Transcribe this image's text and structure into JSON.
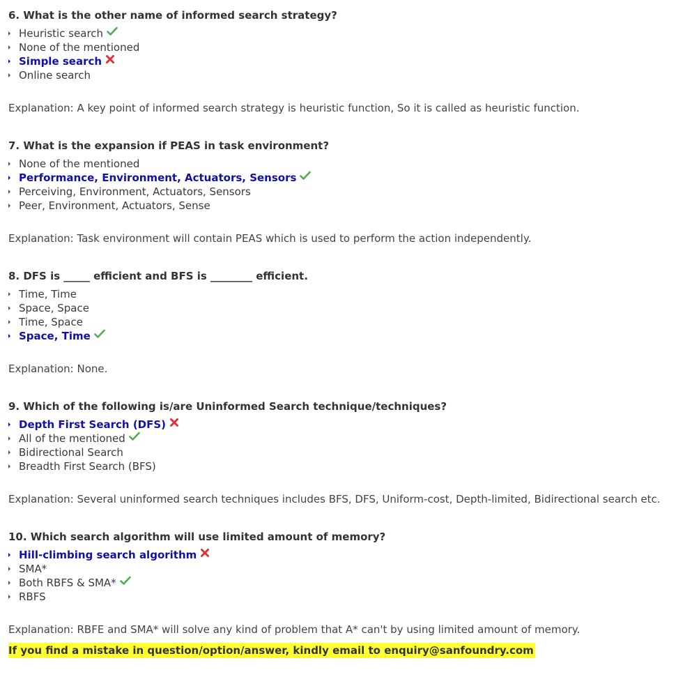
{
  "questions": [
    {
      "title": "6. What is the other name of informed search strategy?",
      "options": [
        {
          "label": "Heuristic search",
          "mark": "check"
        },
        {
          "label": "None of the mentioned",
          "mark": ""
        },
        {
          "label": "Simple search",
          "mark": "cross",
          "selected": true
        },
        {
          "label": "Online search",
          "mark": ""
        }
      ],
      "explanation": "Explanation: A key point of informed search strategy is heuristic function, So it is called as heuristic function."
    },
    {
      "title": "7. What is the expansion if PEAS in task environment?",
      "options": [
        {
          "label": "None of the mentioned",
          "mark": ""
        },
        {
          "label": "Performance, Environment, Actuators, Sensors",
          "mark": "check",
          "selected": true
        },
        {
          "label": "Perceiving, Environment, Actuators, Sensors",
          "mark": ""
        },
        {
          "label": "Peer, Environment, Actuators, Sense",
          "mark": ""
        }
      ],
      "explanation": "Explanation: Task environment will contain PEAS which is used to perform the action independently."
    },
    {
      "title": "8. DFS is _____ efficient and BFS is ________ efficient.",
      "options": [
        {
          "label": "Time, Time",
          "mark": ""
        },
        {
          "label": "Space, Space",
          "mark": ""
        },
        {
          "label": "Time, Space",
          "mark": ""
        },
        {
          "label": "Space, Time",
          "mark": "check",
          "selected": true
        }
      ],
      "explanation": "Explanation: None."
    },
    {
      "title": "9. Which of the following is/are Uninformed Search technique/techniques?",
      "options": [
        {
          "label": "Depth First Search (DFS)",
          "mark": "cross",
          "selected": true
        },
        {
          "label": "All of the mentioned",
          "mark": "check"
        },
        {
          "label": "Bidirectional Search",
          "mark": ""
        },
        {
          "label": "Breadth First Search (BFS)",
          "mark": ""
        }
      ],
      "explanation": "Explanation: Several uninformed search techniques includes BFS, DFS, Uniform-cost, Depth-limited, Bidirectional search etc."
    },
    {
      "title": "10. Which search algorithm will use limited amount of memory?",
      "options": [
        {
          "label": "Hill-climbing search algorithm",
          "mark": "cross",
          "selected": true
        },
        {
          "label": "SMA*",
          "mark": ""
        },
        {
          "label": "Both RBFS & SMA*",
          "mark": "check"
        },
        {
          "label": "RBFS",
          "mark": ""
        }
      ],
      "explanation": "Explanation: RBFE and SMA* will solve any kind of problem that A* can't by using limited amount of memory."
    }
  ],
  "notice": "If you find a mistake in question/option/answer, kindly email to enquiry@sanfoundry.com",
  "colors": {
    "selected": "#1111aa",
    "check": "#4caf50",
    "cross": "#e0303a",
    "highlight": "#ffff33",
    "text": "#3a3a3a"
  },
  "icons": {
    "check": "check-icon",
    "cross": "cross-icon"
  }
}
